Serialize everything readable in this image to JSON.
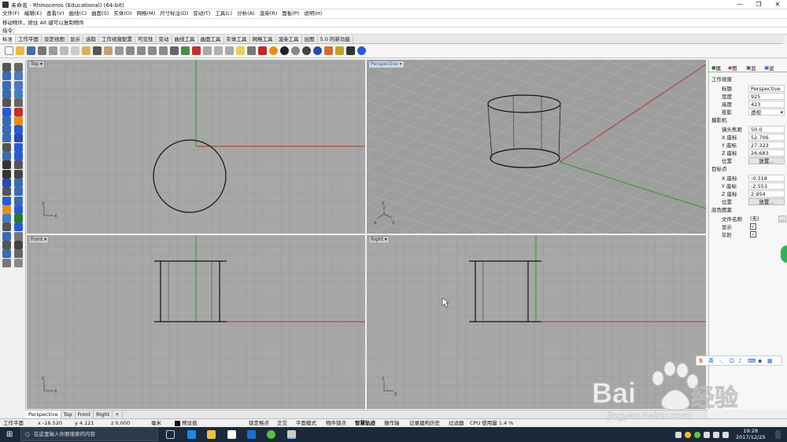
{
  "window": {
    "title": "未命名 - Rhinoceros (Educational) (64-bit)",
    "min": "—",
    "max": "❐",
    "close": "✕"
  },
  "menu": [
    "文件(F)",
    "编辑(E)",
    "查看(V)",
    "曲线(C)",
    "曲面(S)",
    "实体(O)",
    "网格(M)",
    "尺寸标注(D)",
    "变动(T)",
    "工具(L)",
    "分析(A)",
    "渲染(R)",
    "面板(P)",
    "说明(H)"
  ],
  "command_history": "移动物件，按住 Alt 键可以复制物件",
  "command_prompt": "指令：",
  "toolbar_tabs": [
    "标准",
    "工作平面",
    "设定视图",
    "显示",
    "选取",
    "工作视窗配置",
    "可见性",
    "变动",
    "曲线工具",
    "曲面工具",
    "实体工具",
    "网格工具",
    "渲染工具",
    "出图",
    "5.0 的新功能"
  ],
  "viewports": {
    "top": {
      "label": "Top ▾",
      "axis_x": "x",
      "axis_y": "y"
    },
    "perspective": {
      "label": "Perspective ▾",
      "axis_x": "x",
      "axis_y": "y",
      "axis_z": "z"
    },
    "front": {
      "label": "Front ▾",
      "axis_x": "x",
      "axis_z": "z"
    },
    "right": {
      "label": "Right ▾",
      "axis_y": "y",
      "axis_z": "z"
    }
  },
  "view_tabs": [
    "Perspective",
    "Top",
    "Front",
    "Right",
    "+"
  ],
  "panel": {
    "tabs": [
      "属",
      "图",
      "显",
      "说"
    ],
    "section_viewport": "工作视窗",
    "title_label": "标题",
    "title_value": "Perspective",
    "width_label": "宽度",
    "width_value": "925",
    "height_label": "高度",
    "height_value": "423",
    "projection_label": "投影",
    "projection_value": "透视",
    "section_camera": "摄影机",
    "lens_label": "镜头焦距",
    "lens_value": "50.0",
    "camx_label": "X 座标",
    "camx_value": "52.706",
    "camy_label": "Y 座标",
    "camy_value": "27.323",
    "camz_label": "Z 座标",
    "camz_value": "26.683",
    "pos_label": "位置",
    "place_button": "放置...",
    "section_target": "目标点",
    "tgtx_label": "X 座标",
    "tgtx_value": "-0.318",
    "tgty_label": "Y 座标",
    "tgty_value": "-2.553",
    "tgtz_label": "Z 座标",
    "tgtz_value": "2.954",
    "tpos_label": "位置",
    "tplace_button": "放置...",
    "section_wallpaper": "底色图案",
    "file_label": "文件名称",
    "file_value": "(无)",
    "file_button": "...",
    "show_label": "显示",
    "gray_label": "灰阶"
  },
  "status": {
    "cplane": "工作平面",
    "x": "x -16.520",
    "y": "y 4.121",
    "z": "z 0.000",
    "units": "毫米",
    "layer": "预设值",
    "grid_snap": "锁定格点",
    "ortho": "正交",
    "planar": "平面模式",
    "osnap": "物件锁点",
    "smarttrack": "智慧轨迹",
    "gumball": "操作轴",
    "history": "记录建构历史",
    "filter": "过滤器",
    "cpu": "CPU 使用量  1.4 %"
  },
  "ime": {
    "logo": "S",
    "mode": "英"
  },
  "taskbar": {
    "search_placeholder": "在这里输入你要搜索的内容",
    "time": "19:28",
    "date": "2017/12/25"
  },
  "watermark": {
    "brand": "Bai",
    "brand2": "经验",
    "url": "jingyan.baidu.com"
  }
}
